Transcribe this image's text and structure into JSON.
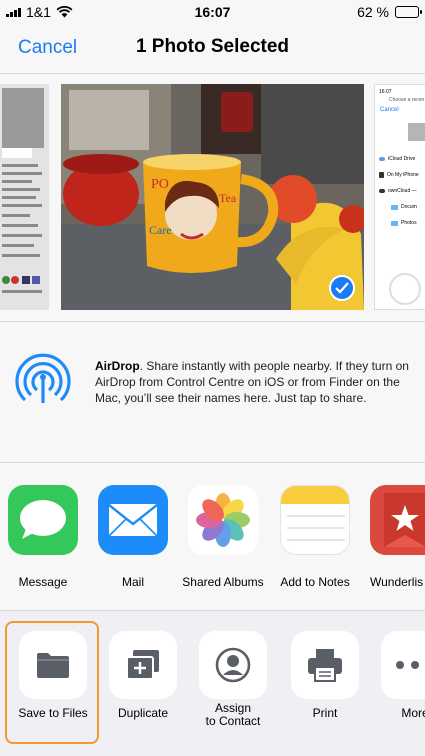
{
  "status_bar": {
    "carrier": "1&1",
    "time": "16:07",
    "battery": "62 %",
    "battery_level": 0.62,
    "icons": [
      "signal-icon",
      "wifi-icon",
      "battery-icon"
    ]
  },
  "nav": {
    "cancel_label": "Cancel",
    "title": "1 Photo Selected"
  },
  "photos": {
    "selected_icon": "checkmark-icon",
    "files_preview": {
      "header": "Choose a recen",
      "cancel": "Cancel",
      "rows": [
        "iCloud Drive",
        "On My iPhone",
        "ownCloud — ",
        "Docum",
        "Photos"
      ]
    }
  },
  "airdrop": {
    "title": "AirDrop",
    "description": ". Share instantly with people nearby. If they turn on AirDrop from Control Centre on iOS or from Finder on the Mac, you’ll see their names here. Just tap to share.",
    "icon": "airdrop-icon"
  },
  "share_apps": [
    {
      "label": "Message",
      "icon": "messages-icon"
    },
    {
      "label": "Mail",
      "icon": "mail-icon"
    },
    {
      "label": "Shared Albums",
      "icon": "photos-icon"
    },
    {
      "label": "Add to Notes",
      "icon": "notes-icon"
    },
    {
      "label": "Wunderlis",
      "icon": "wunderlist-icon"
    }
  ],
  "actions": [
    {
      "label": "Save to Files",
      "icon": "folder-icon",
      "highlighted": true
    },
    {
      "label": "Duplicate",
      "icon": "duplicate-icon"
    },
    {
      "label": "Assign\nto Contact",
      "icon": "contact-icon"
    },
    {
      "label": "Print",
      "icon": "printer-icon"
    },
    {
      "label": "More",
      "icon": "more-icon"
    }
  ],
  "colors": {
    "accent": "#1a7cf5",
    "highlight": "#f29a2e",
    "messages_green": "#34c759",
    "mail_blue": "#1d8cf8",
    "wunderlist_red": "#d9493e"
  }
}
